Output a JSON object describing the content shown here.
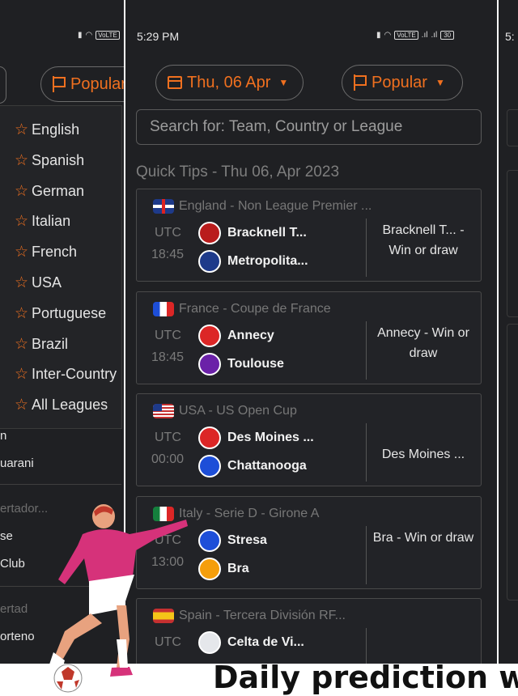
{
  "left_panel": {
    "filter_label": "Popular",
    "dropdown": [
      {
        "label": "English"
      },
      {
        "label": "Spanish"
      },
      {
        "label": "German"
      },
      {
        "label": "Italian"
      },
      {
        "label": "French"
      },
      {
        "label": "USA"
      },
      {
        "label": "Portuguese"
      },
      {
        "label": "Brazil"
      },
      {
        "label": "Inter-Country"
      },
      {
        "label": "All Leagues"
      }
    ],
    "rows": [
      "n",
      "uarani",
      "ertador...",
      "se",
      "Club",
      "ertad",
      "orteno"
    ]
  },
  "center": {
    "status_time": "5:29 PM",
    "status_battery": "30",
    "date_filter": "Thu, 06 Apr",
    "league_filter": "Popular",
    "search_placeholder": "Search for: Team, Country or League",
    "section_title": "Quick Tips - Thu 06, Apr 2023",
    "cards": [
      {
        "flag": "uk",
        "league": "England - Non League Premier ...",
        "tz": "UTC",
        "time": "18:45",
        "home": "Bracknell T...",
        "away": "Metropolita...",
        "tip": "Bracknell T... - Win or draw",
        "home_color": "#b91c1c",
        "away_color": "#1e3a8a"
      },
      {
        "flag": "fr",
        "league": "France - Coupe de France",
        "tz": "UTC",
        "time": "18:45",
        "home": "Annecy",
        "away": "Toulouse",
        "tip": "Annecy - Win or draw",
        "home_color": "#dc2626",
        "away_color": "#6b21a8"
      },
      {
        "flag": "us",
        "league": "USA - US Open Cup",
        "tz": "UTC",
        "time": "00:00",
        "home": "Des Moines ...",
        "away": "Chattanooga",
        "tip": "Des Moines ...",
        "home_color": "#dc2626",
        "away_color": "#1d4ed8"
      },
      {
        "flag": "it",
        "league": "Italy - Serie D - Girone A",
        "tz": "UTC",
        "time": "13:00",
        "home": "Stresa",
        "away": "Bra",
        "tip": "Bra - Win or draw",
        "home_color": "#1d4ed8",
        "away_color": "#f59e0b"
      },
      {
        "flag": "es",
        "league": "Spain - Tercera División RF...",
        "tz": "UTC",
        "time": "",
        "home": "Celta de Vi...",
        "away": "",
        "tip": "",
        "home_color": "#e5e7eb",
        "away_color": ""
      }
    ]
  },
  "right_panel": {
    "status_time": "5:"
  },
  "banner": "Daily prediction w",
  "colors": {
    "accent": "#f0701f",
    "background": "#1f2023"
  }
}
